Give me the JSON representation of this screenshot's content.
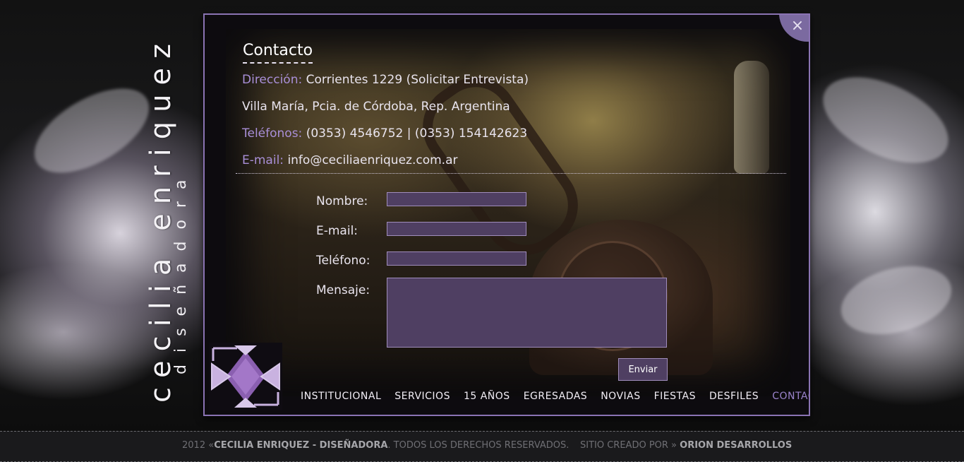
{
  "brand": {
    "name": "cecilia enriquez",
    "subtitle": "diseñadora"
  },
  "contact": {
    "title": "Contacto",
    "address_label": "Dirección:",
    "address_value": "Corrientes 1229 (Solicitar Entrevista)",
    "city": "Villa María, Pcia. de Córdoba, Rep. Argentina",
    "phones_label": "Teléfonos:",
    "phones_value": "(0353) 4546752 | (0353) 154142623",
    "email_label": "E-mail:",
    "email_value": "info@ceciliaenriquez.com.ar"
  },
  "form": {
    "name_label": "Nombre:",
    "email_label": "E-mail:",
    "phone_label": "Teléfono:",
    "message_label": "Mensaje:",
    "name_value": "",
    "email_value": "",
    "phone_value": "",
    "message_value": "",
    "submit_label": "Enviar"
  },
  "close_icon": "×",
  "nav": {
    "items": [
      {
        "label": "INSTITUCIONAL"
      },
      {
        "label": "SERVICIOS"
      },
      {
        "label": "15 AÑOS"
      },
      {
        "label": "EGRESADAS"
      },
      {
        "label": "NOVIAS"
      },
      {
        "label": "FIESTAS"
      },
      {
        "label": "DESFILES"
      },
      {
        "label": "CONTACTO"
      }
    ],
    "active": "CONTACTO"
  },
  "footer": {
    "year": "2012",
    "sep": " «",
    "company": "CECILIA ENRIQUEZ - DISEÑADORA",
    "rights": ". TODOS LOS DERECHOS RESERVADOS.",
    "credit_prefix": "SITIO CREADO POR » ",
    "credit_name": "ORION DESARROLLOS"
  },
  "colors": {
    "accent": "#9a83cb",
    "label_accent": "#a98fd8",
    "field_bg": "#4f3f62",
    "panel_border": "#8a73b3"
  }
}
